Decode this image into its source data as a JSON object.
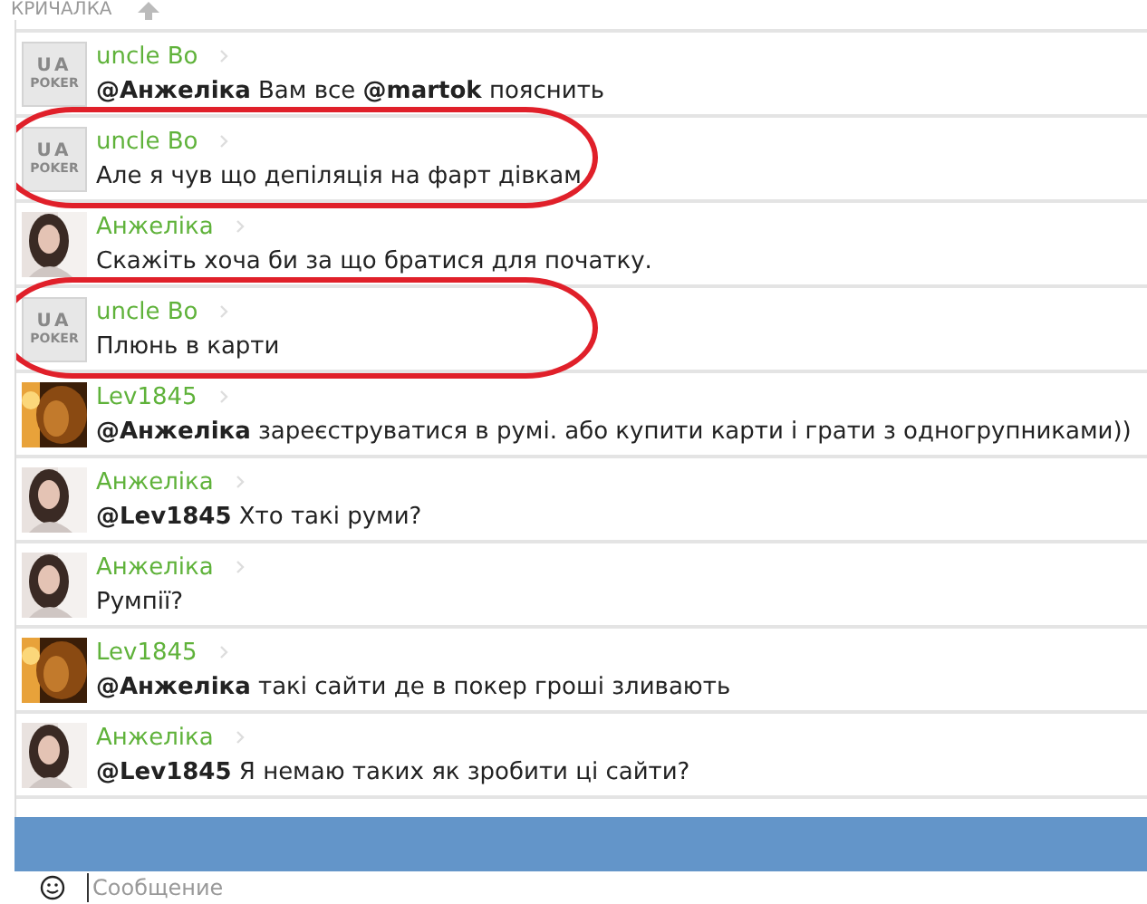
{
  "header": {
    "title": "КРИЧАЛКА"
  },
  "messages": [
    {
      "author": "uncle Bo",
      "avatar": {
        "kind": "logo",
        "lines": [
          "UA",
          "POKER"
        ]
      },
      "text": "**@Анжеліка** Вам все **@martok** пояснить",
      "highlighted": false
    },
    {
      "author": "uncle Bo",
      "avatar": {
        "kind": "logo",
        "lines": [
          "UA",
          "POKER"
        ]
      },
      "text": "Але я чув що депіляція на фарт дівкам",
      "highlighted": true
    },
    {
      "author": "Анжеліка",
      "avatar": {
        "kind": "girl"
      },
      "text": "Скажіть хоча би за що братися для початку.",
      "highlighted": false
    },
    {
      "author": "uncle Bo",
      "avatar": {
        "kind": "logo",
        "lines": [
          "UA",
          "POKER"
        ]
      },
      "text": "Плюнь в карти",
      "highlighted": true
    },
    {
      "author": "Lev1845",
      "avatar": {
        "kind": "lion"
      },
      "text": "**@Анжеліка** зареєструватися в румі. або купити карти і грати з одногрупниками))",
      "highlighted": false
    },
    {
      "author": "Анжеліка",
      "avatar": {
        "kind": "girl"
      },
      "text": "**@Lev1845** Хто такі руми?",
      "highlighted": false
    },
    {
      "author": "Анжеліка",
      "avatar": {
        "kind": "girl"
      },
      "text": "Румпії?",
      "highlighted": false
    },
    {
      "author": "Lev1845",
      "avatar": {
        "kind": "lion"
      },
      "text": "**@Анжеліка** такі сайти де в покер гроші зливають",
      "highlighted": false
    },
    {
      "author": "Анжеліка",
      "avatar": {
        "kind": "girl"
      },
      "text": "**@Lev1845** Я немаю таких як зробити ці сайти?",
      "highlighted": false
    }
  ],
  "composer": {
    "placeholder": "Сообщение"
  }
}
